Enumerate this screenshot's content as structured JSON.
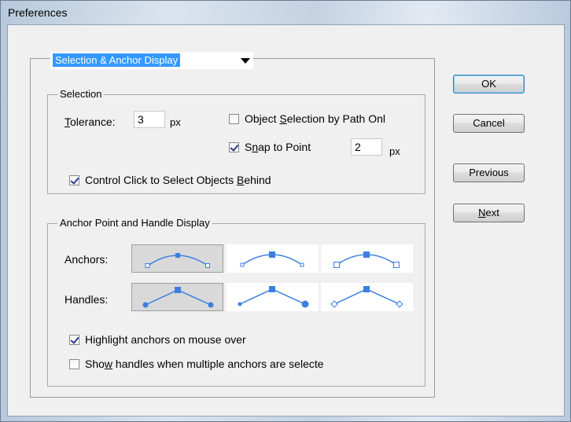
{
  "window": {
    "title": "Preferences"
  },
  "panel_selector": {
    "value": "Selection & Anchor Display"
  },
  "selection": {
    "group_label": "Selection",
    "tolerance": {
      "label_prefix": "",
      "accel": "T",
      "label_rest": "olerance:",
      "value": "3",
      "unit": "px"
    },
    "object_selection_by_path": {
      "pre": "Object ",
      "accel": "S",
      "post": "election by Path Onl",
      "checked": false
    },
    "snap_to_point": {
      "pre": "S",
      "accel": "n",
      "post": "ap to Point",
      "checked": true,
      "value": "2",
      "unit": "px"
    },
    "control_click": {
      "pre": "Control Click to Select Objects ",
      "accel": "B",
      "post": "ehind",
      "checked": true
    }
  },
  "anchor_display": {
    "group_label": "Anchor Point and Handle Display",
    "anchors_label": "Anchors:",
    "handles_label": "Handles:",
    "selected_anchor_option": 1,
    "selected_handle_option": 1,
    "highlight_anchors": {
      "pre": "Hi",
      "accel": "g",
      "post": "hlight anchors on mouse over",
      "checked": true
    },
    "show_handles_multiple": {
      "pre": "Sho",
      "accel": "w",
      "post": " handles when multiple anchors are selecte",
      "checked": false
    }
  },
  "buttons": {
    "ok": "OK",
    "cancel": "Cancel",
    "previous": "Previous",
    "next_accel": "N",
    "next_rest": "ext"
  },
  "colors": {
    "accent": "#3399ff",
    "shape_stroke": "#3d7fe0"
  }
}
